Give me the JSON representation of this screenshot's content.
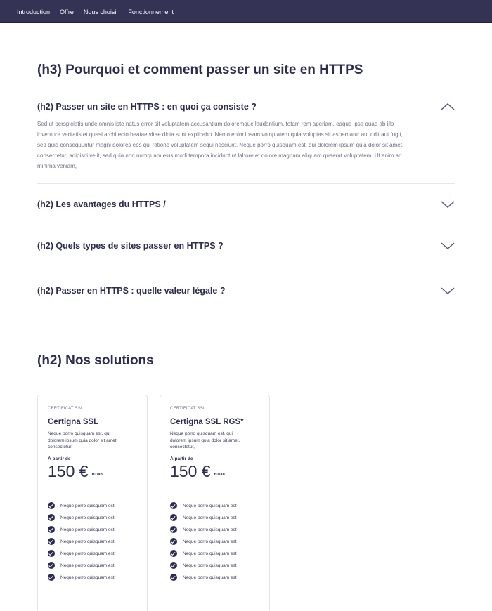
{
  "nav": {
    "items": [
      {
        "label": "Introduction"
      },
      {
        "label": "Offre"
      },
      {
        "label": "Nous choisir"
      },
      {
        "label": "Fonctionnement"
      }
    ]
  },
  "section_title": "(h3) Pourquoi et comment passer un site en HTTPS",
  "accordion": [
    {
      "title": "(h2) Passer un site en HTTPS : en quoi ça consiste ?",
      "expanded": true,
      "body": "Sed ut perspiciatis unde omnis iste natus error sit voluptatem accusantium doloremque laudantium, totam rem aperiam, eaque ipsa quae ab illo inventore veritatis et quasi architecto beatae vitae dicta sunt explicabo. Nemo enim ipsam voluptatem quia voluptas sit aspernatur aut odit aut fugit, sed quia consequuntur magni dolores eos qui ratione voluptatem sequi nesciunt. Neque porro quisquam est, qui dolorem ipsum quia dolor sit amet, consectetur, adipisci velit, sed quia non numquam eius modi tempora incidunt ut labore et dolore magnam aliquam quaerat voluptatem. Ut enim ad minima veniam,"
    },
    {
      "title": "(h2) Les avantages du HTTPS /",
      "expanded": false
    },
    {
      "title": "(h2) Quels types de sites passer en HTTPS ?",
      "expanded": false
    },
    {
      "title": "(h2) Passer en HTTPS : quelle valeur légale ?",
      "expanded": false
    }
  ],
  "solutions_title": "(h2) Nos solutions",
  "cards": [
    {
      "category": "CERTIFICAT SSL",
      "name": "Certigna SSL",
      "description": "Neque porro quisquam est, qui dolorem ipsum quia dolor sit amet, consectetur,",
      "from_label": "À partir de",
      "price": "150 €",
      "price_unit": "HT/an",
      "features": [
        "Neque porro quisquam est",
        "Neque porro quisquam est",
        "Neque porro quisquam est",
        "Neque porro quisquam est",
        "Neque porro quisquam est",
        "Neque porro quisquam est",
        "Neque porro quisquam est"
      ]
    },
    {
      "category": "CERTIFICAT SSL",
      "name": "Certigna SSL RGS*",
      "description": "Neque porro quisquam est, qui dolorem ipsum quia dolor sit amet, consectetur,",
      "from_label": "À partir de",
      "price": "150 €",
      "price_unit": "HT/an",
      "features": [
        "Neque porro quisquam est",
        "Neque porro quisquam est",
        "Neque porro quisquam est",
        "Neque porro quisquam est",
        "Neque porro quisquam est",
        "Neque porro quisquam est",
        "Neque porro quisquam est"
      ]
    }
  ],
  "colors": {
    "nav_bg": "#343355",
    "text_primary": "#2d2c50",
    "text_muted": "#6f6f88",
    "chevron": "#5a5a78"
  },
  "icons": {
    "accordion_open": "chevron-up-icon",
    "accordion_closed": "chevron-down-icon",
    "feature": "check-circle-icon"
  }
}
